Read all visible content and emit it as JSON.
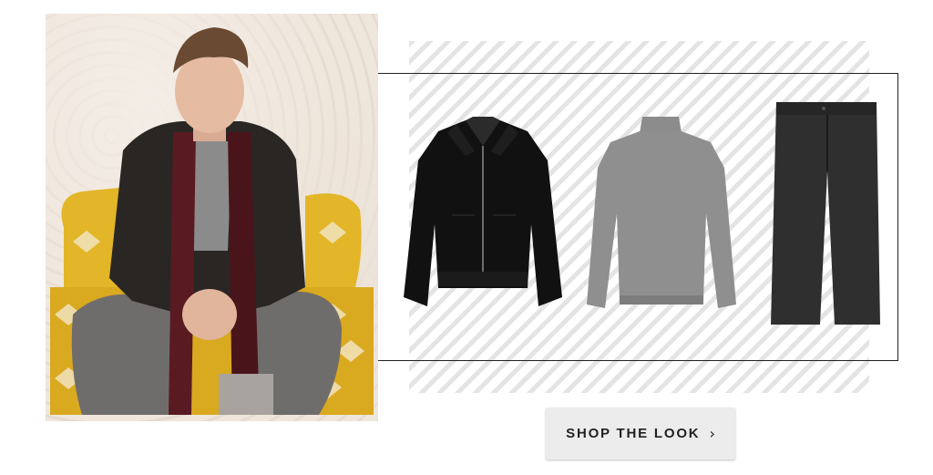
{
  "images": {
    "model_photo": "model-in-leather-jacket-photo",
    "products": [
      {
        "name": "black-leather-jacket"
      },
      {
        "name": "grey-roll-neck-sweater"
      },
      {
        "name": "dark-grey-trousers"
      }
    ]
  },
  "cta": {
    "label": "SHOP THE LOOK",
    "icon": "chevron-right-icon"
  },
  "colors": {
    "button_bg": "#ececec",
    "frame_border": "#222222",
    "chair_yellow": "#e2b628"
  }
}
